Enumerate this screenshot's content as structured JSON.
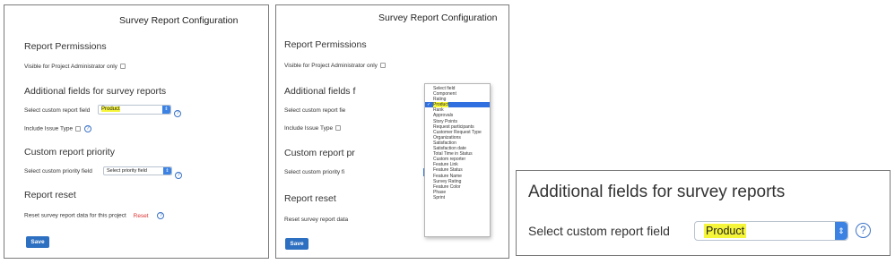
{
  "panel1": {
    "title": "Survey Report Configuration",
    "permissions_heading": "Report Permissions",
    "visible_label": "Visible for Project Administrator only",
    "additional_heading": "Additional fields for survey reports",
    "custom_field_label": "Select custom report field",
    "custom_field_value": "Product",
    "include_issue_type_label": "Include Issue Type",
    "priority_heading": "Custom report priority",
    "priority_label": "Select custom priority field",
    "priority_value": "Select priority field",
    "reset_heading": "Report reset",
    "reset_label": "Reset survey report data for this project",
    "reset_link": "Reset",
    "save_button": "Save"
  },
  "panel2": {
    "title": "Survey Report Configuration",
    "permissions_heading": "Report Permissions",
    "visible_label": "Visible for Project Administrator only",
    "additional_heading": "Additional fields f",
    "custom_field_label": "Select custom report fie",
    "include_issue_type_label": "Include Issue Type",
    "priority_heading": "Custom report pr",
    "priority_label": "Select custom priority fi",
    "reset_heading": "Report reset",
    "reset_label": "Reset survey report data",
    "save_button": "Save",
    "dropdown_options": [
      "Select field",
      "Component",
      "Rating",
      "Product",
      "Rank",
      "Approvals",
      "Story Points",
      "Request participants",
      "Customer Request Type",
      "Organizations",
      "Satisfaction",
      "Satisfaction date",
      "Total Time in Status",
      "Custom reporter",
      "Feature Link",
      "Feature Status",
      "Feature Name",
      "Survey Rating",
      "Feature Color",
      "Phase",
      "Sprint"
    ],
    "selected_option": "Product"
  },
  "zoom": {
    "heading": "Additional fields for survey reports",
    "custom_field_label": "Select custom report field",
    "custom_field_value": "Product"
  },
  "colors": {
    "accent": "#2d6fc0",
    "highlight": "#f5f53a",
    "select_arrow": "#3b82e3",
    "reset_link": "#dd3333"
  }
}
